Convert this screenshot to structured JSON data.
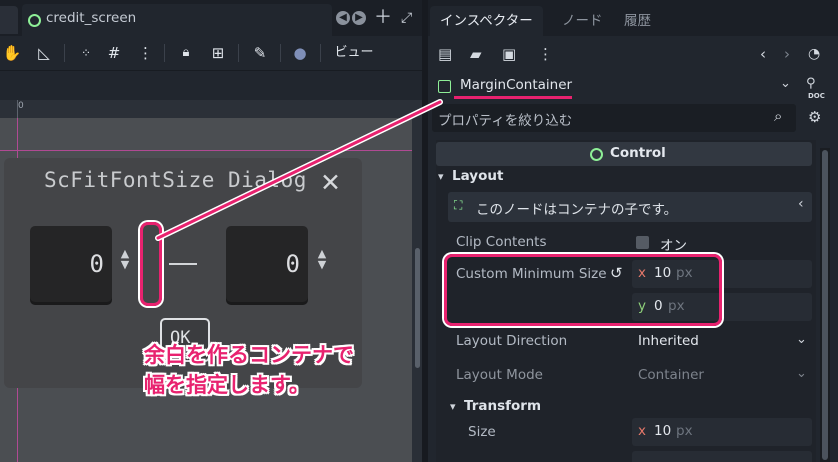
{
  "editor": {
    "scene_tab": {
      "label": "credit_screen"
    },
    "toolbar": {
      "view_menu": "ビュー"
    },
    "ruler": {
      "origin_label": "0"
    },
    "dialog": {
      "title": "ScFitFontSize Dialog",
      "left_value": "0",
      "right_value": "0",
      "ok_label": "OK"
    }
  },
  "annotation": {
    "callout_line1": "余白を作るコンテナで",
    "callout_line2": "幅を指定します。",
    "color": "#e8226f"
  },
  "inspector": {
    "tabs": [
      {
        "label": "インスペクター",
        "active": true
      },
      {
        "label": "ノード",
        "active": false
      },
      {
        "label": "履歴",
        "active": false
      }
    ],
    "doc_label": "DOC",
    "node_name": "MarginContainer",
    "filter_placeholder": "プロパティを絞り込む",
    "class_header": "Control",
    "sections": {
      "layout": "Layout",
      "transform": "Transform"
    },
    "info_text": "このノードはコンテナの子です。",
    "properties": {
      "clip_contents": {
        "label": "Clip Contents",
        "value": "オン"
      },
      "custom_minimum_size": {
        "label": "Custom Minimum Size",
        "x_axis": "x",
        "x_value": "10",
        "x_unit": "px",
        "y_axis": "y",
        "y_value": "0",
        "y_unit": "px"
      },
      "layout_direction": {
        "label": "Layout Direction",
        "value": "Inherited"
      },
      "layout_mode": {
        "label": "Layout Mode",
        "value": "Container"
      },
      "size": {
        "label": "Size",
        "x_axis": "x",
        "x_value": "10",
        "x_unit": "px"
      }
    },
    "colors": {
      "axis_x": "#e5786a",
      "axis_y": "#8ed07a",
      "node_icon": "#8eef97"
    }
  }
}
